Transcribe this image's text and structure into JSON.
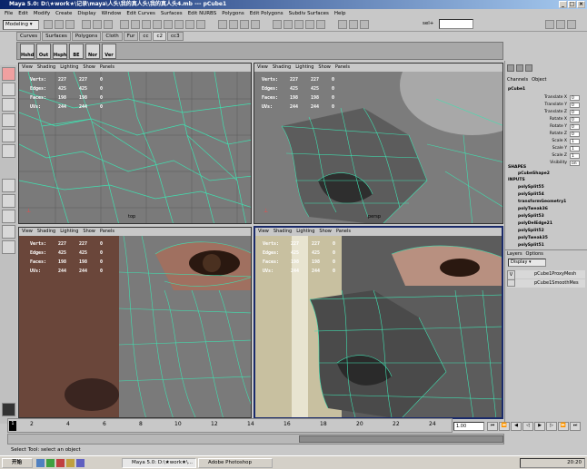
{
  "window": {
    "title": "Maya 5.0: D:\\★work★\\记录\\maya\\人头\\我的真人头\\我的真人头4.mb  ---  pCube1"
  },
  "menu": [
    "File",
    "Edit",
    "Modify",
    "Create",
    "Display",
    "Window",
    "Edit Curves",
    "Surfaces",
    "Edit NURBS",
    "Polygons",
    "Edit Polygons",
    "Subdiv Surfaces",
    "Help"
  ],
  "status": {
    "mode": "Modeling",
    "sel_label": "sel+"
  },
  "shelf": {
    "tabs": [
      "Curves",
      "Surfaces",
      "Polygons",
      "Cloth",
      "Fur",
      "cc",
      "c2",
      "cc3"
    ],
    "buttons": [
      "Hshd",
      "Out",
      "Hsph",
      "BE",
      "Nor",
      "Ver"
    ]
  },
  "panel_menu": [
    "View",
    "Shading",
    "Lighting",
    "Show",
    "Panels"
  ],
  "hud": {
    "rows": [
      {
        "label": "Verts:",
        "a": "227",
        "b": "227",
        "c": "0"
      },
      {
        "label": "Edges:",
        "a": "425",
        "b": "425",
        "c": "0"
      },
      {
        "label": "Faces:",
        "a": "198",
        "b": "198",
        "c": "0"
      },
      {
        "label": "UVs:",
        "a": "244",
        "b": "244",
        "c": "0"
      }
    ]
  },
  "panels": {
    "top_left_cam": "top",
    "top_right_cam": "persp"
  },
  "channel_box": {
    "tabs": [
      "Channels",
      "Object"
    ],
    "object": "pCube1",
    "attributes": [
      {
        "name": "Translate X",
        "value": "0"
      },
      {
        "name": "Translate Y",
        "value": "0"
      },
      {
        "name": "Translate Z",
        "value": "0"
      },
      {
        "name": "Rotate X",
        "value": "0"
      },
      {
        "name": "Rotate Y",
        "value": "0"
      },
      {
        "name": "Rotate Z",
        "value": "0"
      },
      {
        "name": "Scale X",
        "value": "1"
      },
      {
        "name": "Scale Y",
        "value": "1"
      },
      {
        "name": "Scale Z",
        "value": "1"
      },
      {
        "name": "Visibility",
        "value": "on"
      }
    ],
    "shapes_header": "SHAPES",
    "shape": "pCubeShape2",
    "inputs_header": "INPUTS",
    "inputs": [
      "polySplit55",
      "polySplit54",
      "transformGeometry1",
      "polyTweak36",
      "polySplit53",
      "polyDelEdge21",
      "polySplit52",
      "polyTweak35",
      "polySplit51"
    ]
  },
  "layers": {
    "tabs": [
      "Layers",
      "Options"
    ],
    "display_label": "Display",
    "items": [
      {
        "v": "V",
        "name": "pCube1ProxyMesh"
      },
      {
        "v": "",
        "name": "pCube1SmoothMes"
      }
    ]
  },
  "timeline": {
    "ticks": [
      "2",
      "4",
      "6",
      "8",
      "10",
      "12",
      "14",
      "16",
      "18",
      "20",
      "22",
      "24"
    ],
    "current": "1",
    "start": "1.00",
    "end": "1.00"
  },
  "cmdline": {
    "help": "Select Tool: select an object"
  },
  "taskbar": {
    "start": "开始",
    "tasks": [
      "Maya 5.0: D:\\★work★\\...",
      "Adobe Photoshop"
    ],
    "clock": "20:20"
  }
}
